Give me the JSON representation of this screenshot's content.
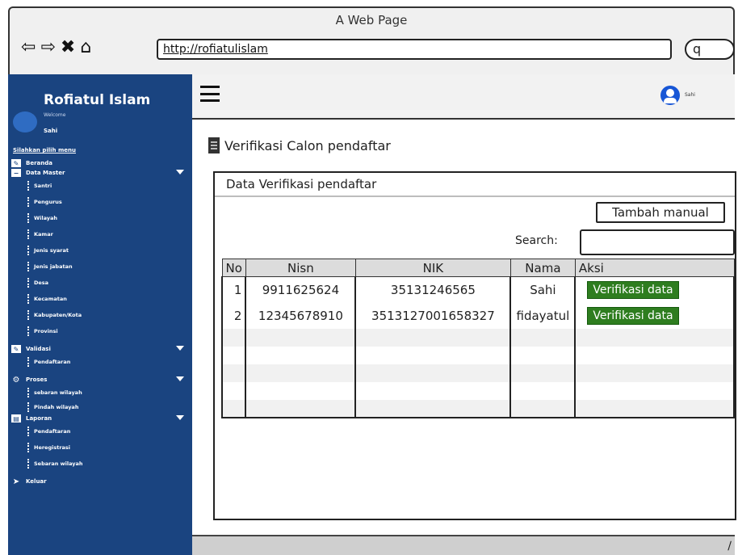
{
  "window": {
    "title": "A Web Page"
  },
  "browser": {
    "url": "http://rofiatulislam",
    "icons": {
      "back": "⇦",
      "forward": "⇨",
      "stop": "✖",
      "home": "⌂",
      "search": "q"
    }
  },
  "sidebar": {
    "brand": "Rofiatul Islam",
    "welcome": "Welcome",
    "user": "Sahi",
    "menu_hint": "Silahkan pilih menu",
    "items": [
      {
        "label": "Beranda",
        "icon": "edit-icon"
      },
      {
        "label": "Data Master",
        "icon": "minus-box-icon",
        "children": [
          "Santri",
          "Pengurus",
          "Wilayah",
          "Kamar",
          "Jenis syarat",
          "Jenis jabatan",
          "Desa",
          "Kecamatan",
          "Kabupaten/Kota",
          "Provinsi"
        ]
      },
      {
        "label": "Validasi",
        "icon": "edit-icon",
        "children": [
          "Pendaftaran"
        ]
      },
      {
        "label": "Proses",
        "icon": "gear-icon",
        "children": [
          "sebaran wilayah",
          "Pindah wilayah"
        ]
      },
      {
        "label": "Laporan",
        "icon": "document-icon",
        "children": [
          "Pendaftaran",
          "Heregistrasi",
          "Sebaran wilayah"
        ]
      },
      {
        "label": "Keluar",
        "icon": "logout-icon"
      }
    ]
  },
  "topbar": {
    "user": "Sahi"
  },
  "page": {
    "title": "Verifikasi Calon pendaftar",
    "panel_title": "Data Verifikasi pendaftar",
    "add_button": "Tambah manual",
    "search_label": "Search:"
  },
  "table": {
    "headers": [
      "No",
      "Nisn",
      "NIK",
      "Nama",
      "Aksi"
    ],
    "rows": [
      {
        "no": "1",
        "nisn": "9911625624",
        "nik": "35131246565",
        "nama": "Sahi",
        "action": "Verifikasi data"
      },
      {
        "no": "2",
        "nisn": "12345678910",
        "nik": "3513127001658327",
        "nama": "fidayatul",
        "action": "Verifikasi data"
      }
    ]
  }
}
